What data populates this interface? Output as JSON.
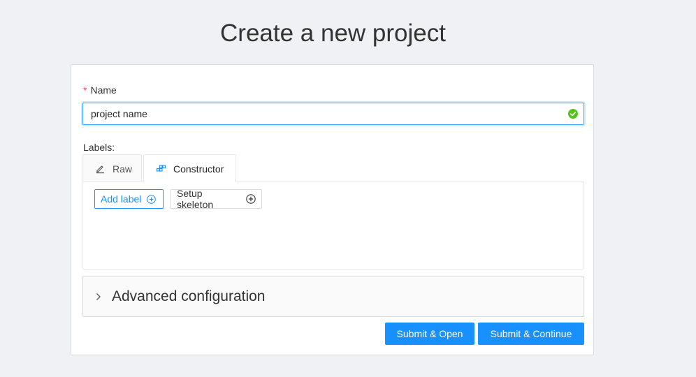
{
  "page": {
    "title": "Create a new project"
  },
  "form": {
    "name": {
      "required_mark": "*",
      "label": "Name",
      "value": "project name",
      "status_icon": "check-circle-icon"
    },
    "labels": {
      "caption": "Labels:",
      "tabs": [
        {
          "label": "Raw",
          "icon": "edit-icon",
          "active": false
        },
        {
          "label": "Constructor",
          "icon": "build-icon",
          "active": true
        }
      ],
      "add_label_button": "Add label",
      "setup_skeleton_button": "Setup skeleton"
    },
    "advanced": {
      "label": "Advanced configuration",
      "icon": "chevron-right-icon"
    },
    "actions": {
      "submit_open": "Submit & Open",
      "submit_continue": "Submit & Continue"
    }
  },
  "colors": {
    "primary": "#1890ff",
    "success": "#52c41a",
    "required": "#ff4d4f",
    "background": "#f0f1f5"
  }
}
